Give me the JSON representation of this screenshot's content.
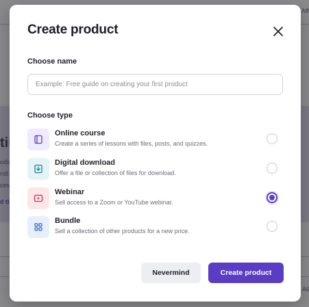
{
  "modal": {
    "title": "Create product",
    "close_icon": "close-icon"
  },
  "name_section": {
    "label": "Choose name",
    "placeholder": "Example: Free guide on creating your first product",
    "value": ""
  },
  "type_section": {
    "label": "Choose type",
    "options": [
      {
        "name": "Online course",
        "description": "Create a series of lessons with files, posts, and quizzes.",
        "icon": "course-icon",
        "icon_bg": "#efeafd",
        "icon_color": "#5b3cc4",
        "selected": false
      },
      {
        "name": "Digital download",
        "description": "Offer a file or collection of files for download.",
        "icon": "download-icon",
        "icon_bg": "#e4f3f6",
        "icon_color": "#1f7f95",
        "selected": false
      },
      {
        "name": "Webinar",
        "description": "Sell access to a Zoom or YouTube webinar.",
        "icon": "video-icon",
        "icon_bg": "#fbe7ea",
        "icon_color": "#d2304a",
        "selected": true
      },
      {
        "name": "Bundle",
        "description": "Sell a collection of other products for a new price.",
        "icon": "bundle-icon",
        "icon_bg": "#e7effc",
        "icon_color": "#2f62c8",
        "selected": false
      }
    ]
  },
  "actions": {
    "cancel_label": "Nevermind",
    "create_label": "Create product"
  },
  "background": {
    "fragment_top_right": "Affilia",
    "fragment_heading": "tin",
    "fragment_1": "odia",
    "fragment_2": "ndl",
    "fragment_3": "ces",
    "fragment_link": "d ti",
    "fragment_bottom_right": "All p"
  },
  "colors": {
    "accent": "#5b3cc4",
    "text_primary": "#1f1f29",
    "text_secondary": "#6c6c76"
  }
}
